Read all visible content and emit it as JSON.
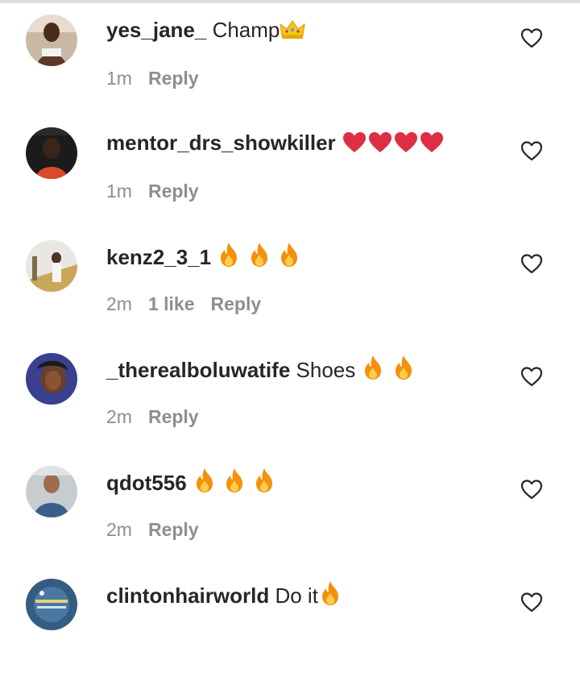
{
  "comments": [
    {
      "username": "yes_jane_",
      "text": "Champ",
      "emoji": [
        "crown"
      ],
      "time": "1m",
      "likes": "",
      "reply_label": "Reply"
    },
    {
      "username": "mentor_drs_showkiller",
      "text": "",
      "emoji": [
        "red-heart",
        "red-heart",
        "red-heart",
        "red-heart"
      ],
      "time": "1m",
      "likes": "",
      "reply_label": "Reply"
    },
    {
      "username": "kenz2_3_1",
      "text": "",
      "emoji": [
        "fire",
        "fire",
        "fire"
      ],
      "time": "2m",
      "likes": "1 like",
      "reply_label": "Reply"
    },
    {
      "username": "_therealboluwatife",
      "text": "Shoes",
      "emoji": [
        "fire",
        "fire"
      ],
      "time": "2m",
      "likes": "",
      "reply_label": "Reply"
    },
    {
      "username": "qdot556",
      "text": "",
      "emoji": [
        "fire",
        "fire",
        "fire"
      ],
      "time": "2m",
      "likes": "",
      "reply_label": "Reply"
    },
    {
      "username": "clintonhairworld",
      "text": "Do it",
      "emoji": [
        "fire"
      ],
      "time": "",
      "likes": "",
      "reply_label": ""
    }
  ],
  "colors": {
    "username": "#262626",
    "meta": "#8e8e8e",
    "heart_outline": "#262626",
    "emoji_heart": "#e0245e",
    "emoji_fire": "#f7931e",
    "emoji_crown": "#f5c518"
  },
  "icons": {
    "like": "heart-outline-icon"
  }
}
